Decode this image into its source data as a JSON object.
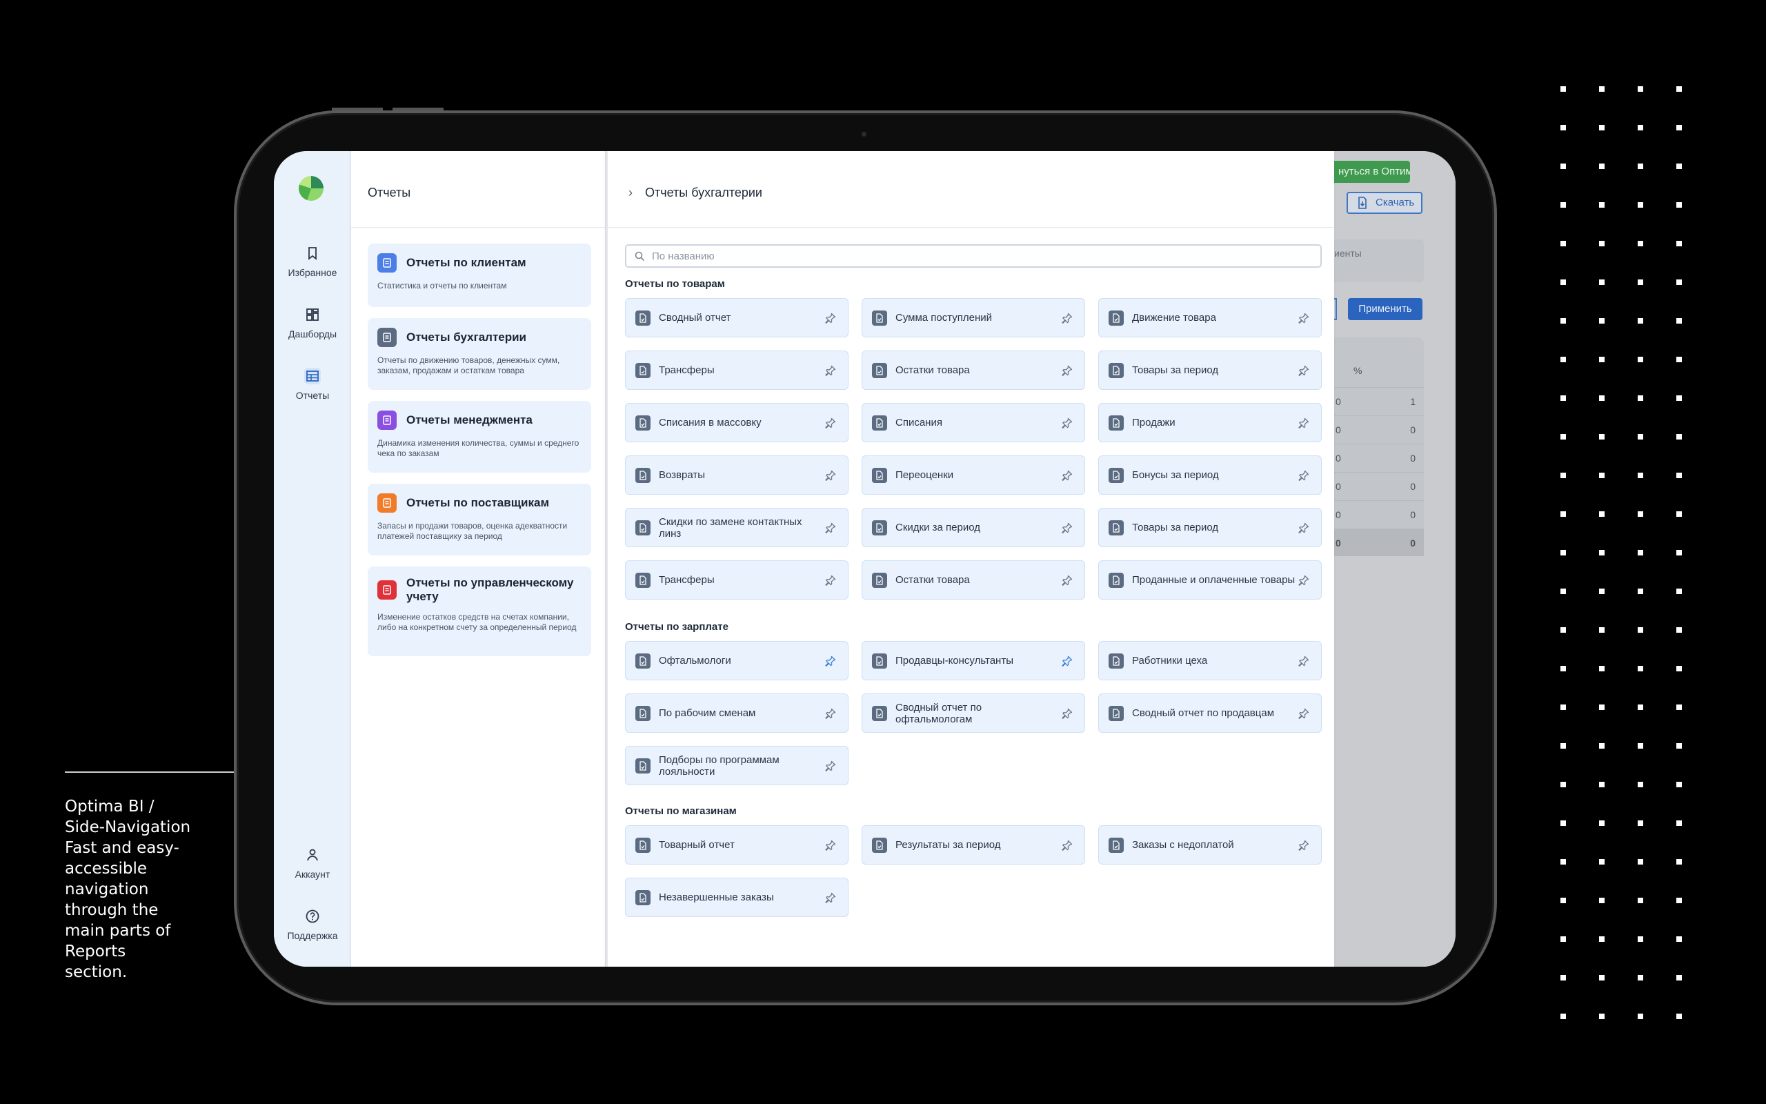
{
  "caption": {
    "lines": [
      "Optima BI /",
      "Side-Navigation",
      "Fast and easy-",
      "accessible",
      "navigation",
      "through the",
      "main parts of",
      "Reports",
      "section."
    ]
  },
  "rail": {
    "items": [
      {
        "label": "Избранное",
        "icon": "bookmark-icon"
      },
      {
        "label": "Дашборды",
        "icon": "dashboard-icon"
      },
      {
        "label": "Отчеты",
        "icon": "table-icon",
        "active": true
      },
      {
        "label": "Аккаунт",
        "icon": "user-icon"
      },
      {
        "label": "Поддержка",
        "icon": "help-icon"
      }
    ]
  },
  "panel": {
    "title": "Отчеты",
    "categories": [
      {
        "title": "Отчеты по клиентам",
        "desc": "Статистика и отчеты по клиентам",
        "color": "#4c7fe6"
      },
      {
        "title": "Отчеты бухгалтерии",
        "desc": "Отчеты по движению товаров, денежных сумм, заказам, продажам и остаткам товара",
        "color": "#5b6b82"
      },
      {
        "title": "Отчеты менеджмента",
        "desc": "Динамика изменения количества, суммы и среднего чека по заказам",
        "color": "#8a4fe0"
      },
      {
        "title": "Отчеты по поставщикам",
        "desc": "Запасы и продажи товаров, оценка адекватности платежей поставщику за период",
        "color": "#f07c2a"
      },
      {
        "title": "Отчеты по управленческому учету",
        "desc": "Изменение остатков средств на счетах компании, либо на конкретном счету за определенный период",
        "color": "#e0313a"
      }
    ]
  },
  "main": {
    "breadcrumb": "Отчеты бухгалтерии",
    "search_placeholder": "По названию",
    "sections": [
      {
        "title": "Отчеты по товарам",
        "items": [
          {
            "label": "Сводный отчет",
            "pinned": false
          },
          {
            "label": "Сумма поступлений",
            "pinned": false
          },
          {
            "label": "Движение товара",
            "pinned": false
          },
          {
            "label": "Трансферы",
            "pinned": false
          },
          {
            "label": "Остатки товара",
            "pinned": false
          },
          {
            "label": "Товары за период",
            "pinned": false
          },
          {
            "label": "Списания в массовку",
            "pinned": false
          },
          {
            "label": "Списания",
            "pinned": false
          },
          {
            "label": "Продажи",
            "pinned": false
          },
          {
            "label": "Возвраты",
            "pinned": false
          },
          {
            "label": "Переоценки",
            "pinned": false
          },
          {
            "label": "Бонусы за период",
            "pinned": false
          },
          {
            "label": "Скидки по замене контактных линз",
            "pinned": false
          },
          {
            "label": "Скидки за период",
            "pinned": false
          },
          {
            "label": "Товары за период",
            "pinned": false
          },
          {
            "label": "Трансферы",
            "pinned": false
          },
          {
            "label": "Остатки товара",
            "pinned": false
          },
          {
            "label": "Проданные и оплаченные товары",
            "pinned": false
          }
        ]
      },
      {
        "title": "Отчеты по зарплате",
        "items": [
          {
            "label": "Офтальмологи",
            "pinned": true
          },
          {
            "label": "Продавцы-консультанты",
            "pinned": true
          },
          {
            "label": "Работники цеха",
            "pinned": false
          },
          {
            "label": "По рабочим сменам",
            "pinned": false
          },
          {
            "label": "Сводный отчет по офтальмологам",
            "pinned": false
          },
          {
            "label": "Сводный отчет по продавцам",
            "pinned": false
          },
          {
            "label": "Подборы по программам лояльности",
            "pinned": false
          }
        ]
      },
      {
        "title": "Отчеты по магазинам",
        "items": [
          {
            "label": "Товарный отчет",
            "pinned": false
          },
          {
            "label": "Результаты за период",
            "pinned": false
          },
          {
            "label": "Заказы с недоплатой",
            "pinned": false
          },
          {
            "label": "Незавершенные заказы",
            "pinned": false
          }
        ]
      }
    ]
  },
  "background": {
    "return_button": "нуться в Оптима",
    "download_button": "Скачать",
    "field_fragment": "иенты",
    "apply_button": "Применить",
    "table_header": "%",
    "table_rows": [
      [
        "0",
        "1"
      ],
      [
        "0",
        "0"
      ],
      [
        "0",
        "0"
      ],
      [
        "0",
        "0"
      ],
      [
        "0",
        "0"
      ],
      [
        "0",
        "0"
      ]
    ]
  },
  "colors": {
    "accent": "#2a64be",
    "pin_active": "#3b82d6",
    "tile_bg": "#e9f2fd",
    "rail_bg": "#e9f1fb"
  }
}
